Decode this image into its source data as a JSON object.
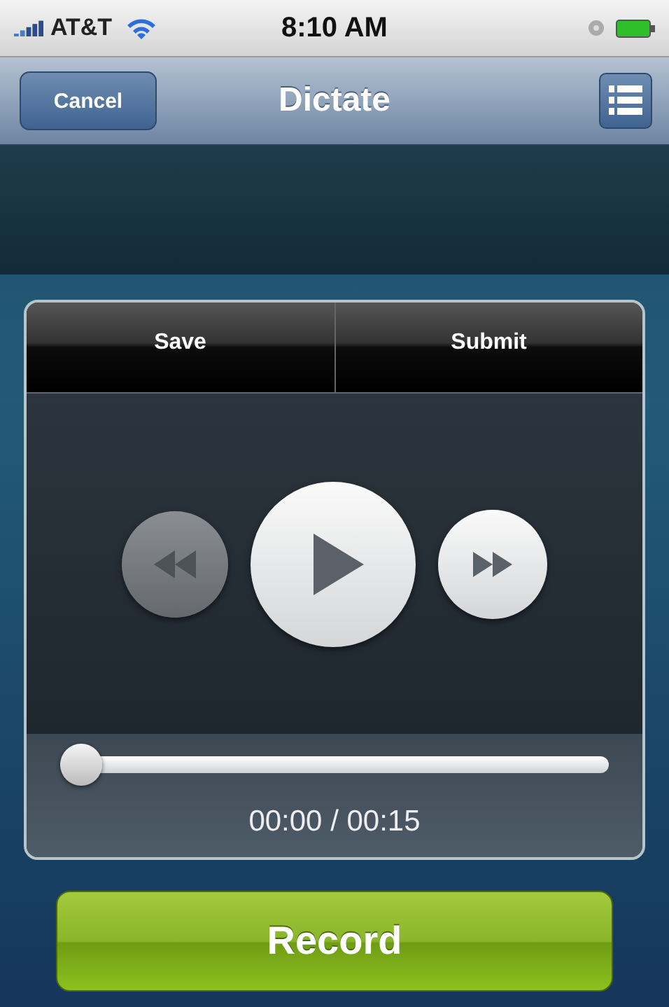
{
  "status_bar": {
    "carrier": "AT&T",
    "time": "8:10 AM"
  },
  "nav_bar": {
    "left_button": "Cancel",
    "title": "Dictate"
  },
  "player": {
    "buttons": [
      "Save",
      "Submit"
    ],
    "controls": [
      {
        "kind": "rewind",
        "disabled": true
      },
      {
        "kind": "play",
        "disabled": false
      },
      {
        "kind": "forward",
        "disabled": false
      }
    ],
    "progress": {
      "level": 0,
      "time": "00:00 / 00:15"
    }
  },
  "record_button": "Record"
}
